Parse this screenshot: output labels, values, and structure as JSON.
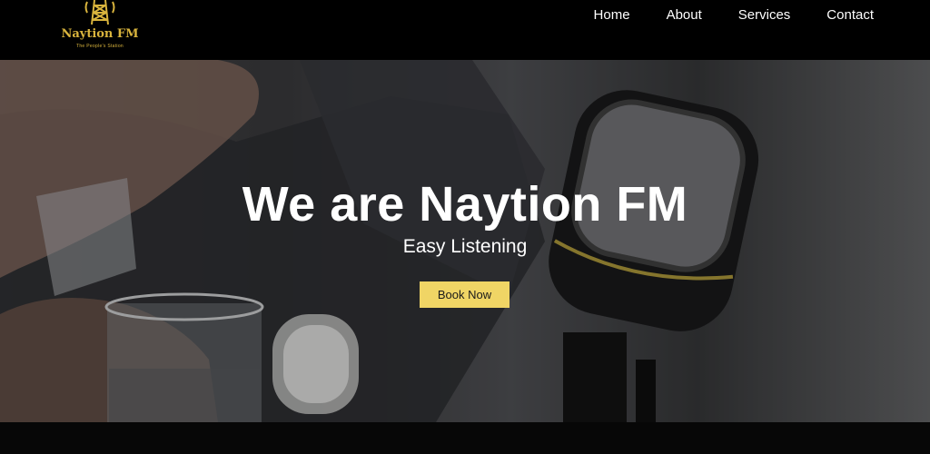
{
  "header": {
    "logo": {
      "name": "Naytion FM",
      "tagline": "The People's Station",
      "icon": "radio-tower-icon",
      "color": "#d9b43d"
    },
    "nav": [
      {
        "label": "Home"
      },
      {
        "label": "About"
      },
      {
        "label": "Services"
      },
      {
        "label": "Contact"
      }
    ]
  },
  "hero": {
    "title": "We are Naytion FM",
    "subtitle": "Easy Listening",
    "cta_label": "Book Now",
    "cta_color": "#f0d565",
    "background_image": "man-with-studio-microphone-and-glass"
  }
}
